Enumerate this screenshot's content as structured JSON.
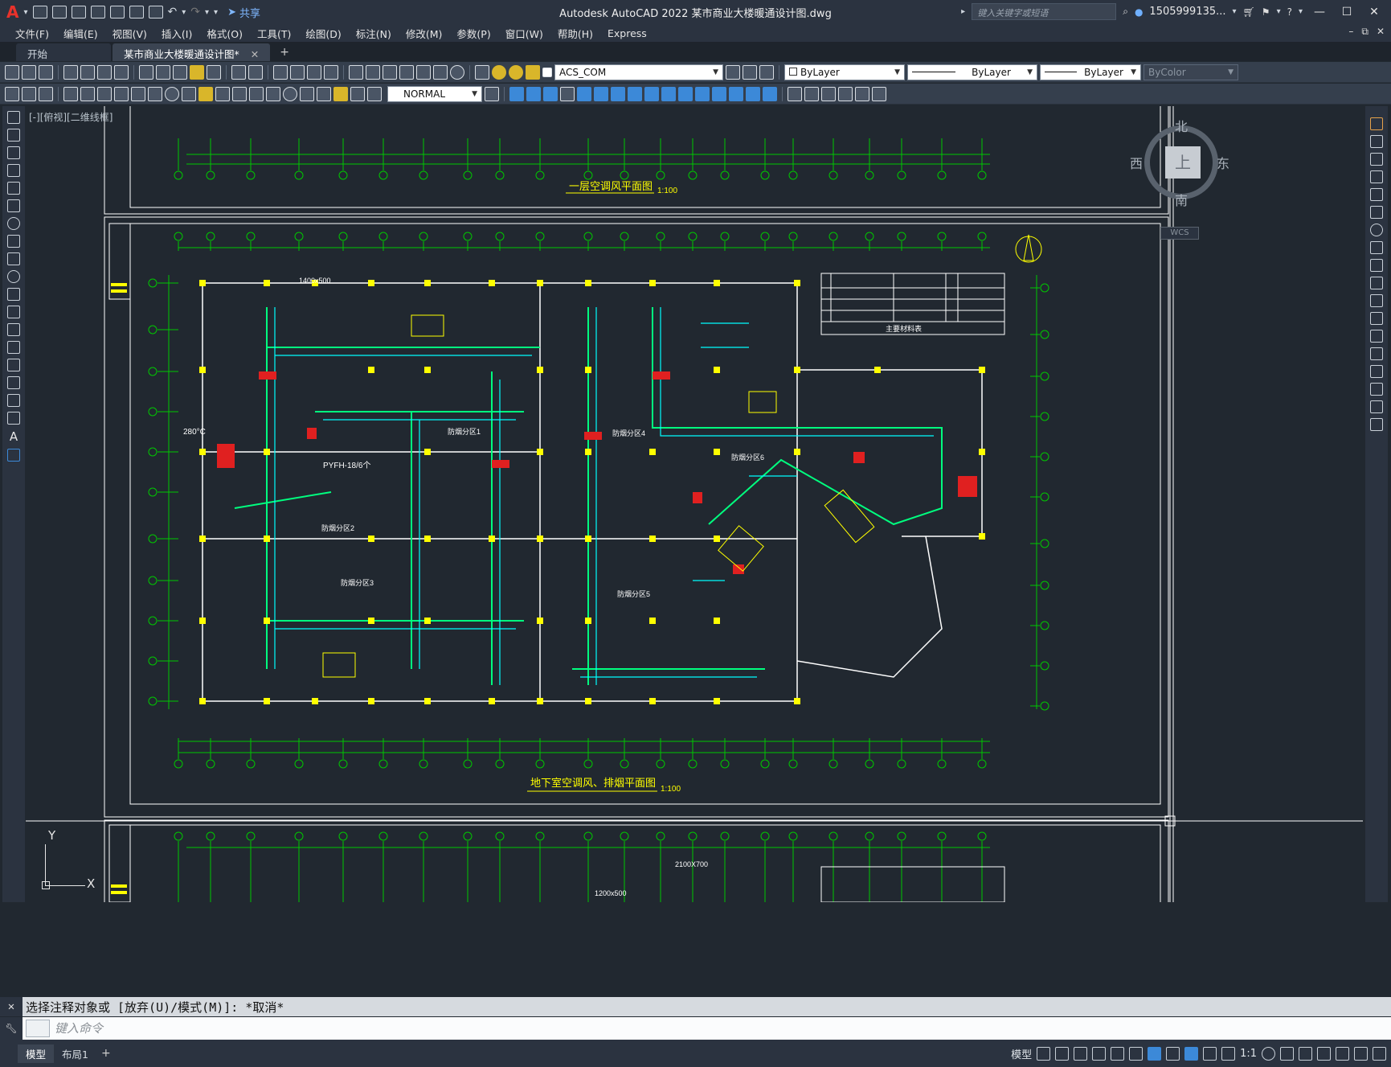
{
  "app": {
    "title": "Autodesk AutoCAD 2022    某市商业大楼暖通设计图.dwg",
    "share_label": "共享",
    "search_placeholder": "键入关键字或短语",
    "user": "1505999135...",
    "window_controls": [
      "minimize-icon",
      "maximize-icon",
      "close-icon"
    ]
  },
  "menubar": {
    "items": [
      "文件(F)",
      "编辑(E)",
      "视图(V)",
      "插入(I)",
      "格式(O)",
      "工具(T)",
      "绘图(D)",
      "标注(N)",
      "修改(M)",
      "参数(P)",
      "窗口(W)",
      "帮助(H)",
      "Express"
    ]
  },
  "tabs": {
    "items": [
      {
        "label": "开始",
        "active": false
      },
      {
        "label": "某市商业大楼暖通设计图*",
        "active": true
      }
    ]
  },
  "toolbar": {
    "layer": "ACS_COM",
    "color": "ByLayer",
    "linetype": "ByLayer",
    "lineweight": "ByLayer",
    "plotstyle": "ByColor",
    "textstyle": "NORMAL"
  },
  "viewport": {
    "label": "[-][俯视][二维线框]",
    "viewcube": {
      "north": "北",
      "south": "南",
      "east": "东",
      "west": "西",
      "face": "上",
      "wcs": "WCS"
    },
    "ucs": {
      "x": "X",
      "y": "Y"
    }
  },
  "drawing": {
    "top_title": "一层空调风平面图",
    "top_scale": "1:100",
    "main_title": "地下室空调风、排烟平面图",
    "main_scale": "1:100",
    "labels": {
      "a": "280°C",
      "b": "PYFH-18/6个",
      "c": "1400x500",
      "d": "2100X700",
      "e": "防烟分区1",
      "f": "防烟分区2",
      "g": "防烟分区3",
      "h": "防烟分区4",
      "i": "防烟分区5",
      "j": "防烟分区6",
      "k": "主要材料表",
      "l": "1200x500"
    }
  },
  "command": {
    "history": "选择注释对象或 [放弃(U)/模式(M)]: *取消*",
    "placeholder": "键入命令"
  },
  "statusbar": {
    "layouts": [
      {
        "label": "模型",
        "active": true
      },
      {
        "label": "布局1",
        "active": false
      }
    ],
    "model_label": "模型",
    "scale": "1:1"
  },
  "colors": {
    "canvas": "#212830",
    "frame": "#ffffff",
    "duct": "#00ff7f",
    "cyan": "#00ffff",
    "yellow": "#ffff00",
    "grid": "#00c800",
    "accent": "#3c89d8"
  }
}
